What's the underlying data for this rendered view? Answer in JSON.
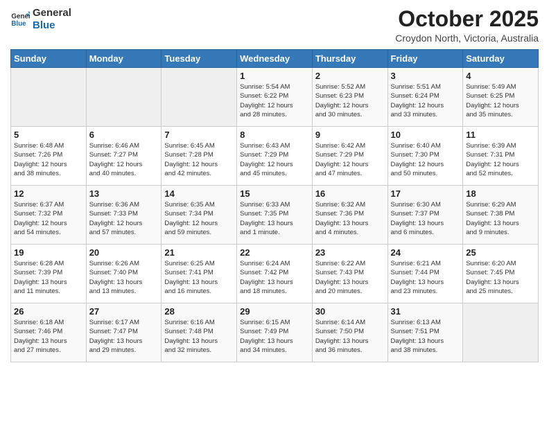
{
  "logo": {
    "line1": "General",
    "line2": "Blue"
  },
  "header": {
    "month": "October 2025",
    "location": "Croydon North, Victoria, Australia"
  },
  "weekdays": [
    "Sunday",
    "Monday",
    "Tuesday",
    "Wednesday",
    "Thursday",
    "Friday",
    "Saturday"
  ],
  "weeks": [
    [
      {
        "day": "",
        "info": ""
      },
      {
        "day": "",
        "info": ""
      },
      {
        "day": "",
        "info": ""
      },
      {
        "day": "1",
        "info": "Sunrise: 5:54 AM\nSunset: 6:22 PM\nDaylight: 12 hours\nand 28 minutes."
      },
      {
        "day": "2",
        "info": "Sunrise: 5:52 AM\nSunset: 6:23 PM\nDaylight: 12 hours\nand 30 minutes."
      },
      {
        "day": "3",
        "info": "Sunrise: 5:51 AM\nSunset: 6:24 PM\nDaylight: 12 hours\nand 33 minutes."
      },
      {
        "day": "4",
        "info": "Sunrise: 5:49 AM\nSunset: 6:25 PM\nDaylight: 12 hours\nand 35 minutes."
      }
    ],
    [
      {
        "day": "5",
        "info": "Sunrise: 6:48 AM\nSunset: 7:26 PM\nDaylight: 12 hours\nand 38 minutes."
      },
      {
        "day": "6",
        "info": "Sunrise: 6:46 AM\nSunset: 7:27 PM\nDaylight: 12 hours\nand 40 minutes."
      },
      {
        "day": "7",
        "info": "Sunrise: 6:45 AM\nSunset: 7:28 PM\nDaylight: 12 hours\nand 42 minutes."
      },
      {
        "day": "8",
        "info": "Sunrise: 6:43 AM\nSunset: 7:29 PM\nDaylight: 12 hours\nand 45 minutes."
      },
      {
        "day": "9",
        "info": "Sunrise: 6:42 AM\nSunset: 7:29 PM\nDaylight: 12 hours\nand 47 minutes."
      },
      {
        "day": "10",
        "info": "Sunrise: 6:40 AM\nSunset: 7:30 PM\nDaylight: 12 hours\nand 50 minutes."
      },
      {
        "day": "11",
        "info": "Sunrise: 6:39 AM\nSunset: 7:31 PM\nDaylight: 12 hours\nand 52 minutes."
      }
    ],
    [
      {
        "day": "12",
        "info": "Sunrise: 6:37 AM\nSunset: 7:32 PM\nDaylight: 12 hours\nand 54 minutes."
      },
      {
        "day": "13",
        "info": "Sunrise: 6:36 AM\nSunset: 7:33 PM\nDaylight: 12 hours\nand 57 minutes."
      },
      {
        "day": "14",
        "info": "Sunrise: 6:35 AM\nSunset: 7:34 PM\nDaylight: 12 hours\nand 59 minutes."
      },
      {
        "day": "15",
        "info": "Sunrise: 6:33 AM\nSunset: 7:35 PM\nDaylight: 13 hours\nand 1 minute."
      },
      {
        "day": "16",
        "info": "Sunrise: 6:32 AM\nSunset: 7:36 PM\nDaylight: 13 hours\nand 4 minutes."
      },
      {
        "day": "17",
        "info": "Sunrise: 6:30 AM\nSunset: 7:37 PM\nDaylight: 13 hours\nand 6 minutes."
      },
      {
        "day": "18",
        "info": "Sunrise: 6:29 AM\nSunset: 7:38 PM\nDaylight: 13 hours\nand 9 minutes."
      }
    ],
    [
      {
        "day": "19",
        "info": "Sunrise: 6:28 AM\nSunset: 7:39 PM\nDaylight: 13 hours\nand 11 minutes."
      },
      {
        "day": "20",
        "info": "Sunrise: 6:26 AM\nSunset: 7:40 PM\nDaylight: 13 hours\nand 13 minutes."
      },
      {
        "day": "21",
        "info": "Sunrise: 6:25 AM\nSunset: 7:41 PM\nDaylight: 13 hours\nand 16 minutes."
      },
      {
        "day": "22",
        "info": "Sunrise: 6:24 AM\nSunset: 7:42 PM\nDaylight: 13 hours\nand 18 minutes."
      },
      {
        "day": "23",
        "info": "Sunrise: 6:22 AM\nSunset: 7:43 PM\nDaylight: 13 hours\nand 20 minutes."
      },
      {
        "day": "24",
        "info": "Sunrise: 6:21 AM\nSunset: 7:44 PM\nDaylight: 13 hours\nand 23 minutes."
      },
      {
        "day": "25",
        "info": "Sunrise: 6:20 AM\nSunset: 7:45 PM\nDaylight: 13 hours\nand 25 minutes."
      }
    ],
    [
      {
        "day": "26",
        "info": "Sunrise: 6:18 AM\nSunset: 7:46 PM\nDaylight: 13 hours\nand 27 minutes."
      },
      {
        "day": "27",
        "info": "Sunrise: 6:17 AM\nSunset: 7:47 PM\nDaylight: 13 hours\nand 29 minutes."
      },
      {
        "day": "28",
        "info": "Sunrise: 6:16 AM\nSunset: 7:48 PM\nDaylight: 13 hours\nand 32 minutes."
      },
      {
        "day": "29",
        "info": "Sunrise: 6:15 AM\nSunset: 7:49 PM\nDaylight: 13 hours\nand 34 minutes."
      },
      {
        "day": "30",
        "info": "Sunrise: 6:14 AM\nSunset: 7:50 PM\nDaylight: 13 hours\nand 36 minutes."
      },
      {
        "day": "31",
        "info": "Sunrise: 6:13 AM\nSunset: 7:51 PM\nDaylight: 13 hours\nand 38 minutes."
      },
      {
        "day": "",
        "info": ""
      }
    ]
  ]
}
